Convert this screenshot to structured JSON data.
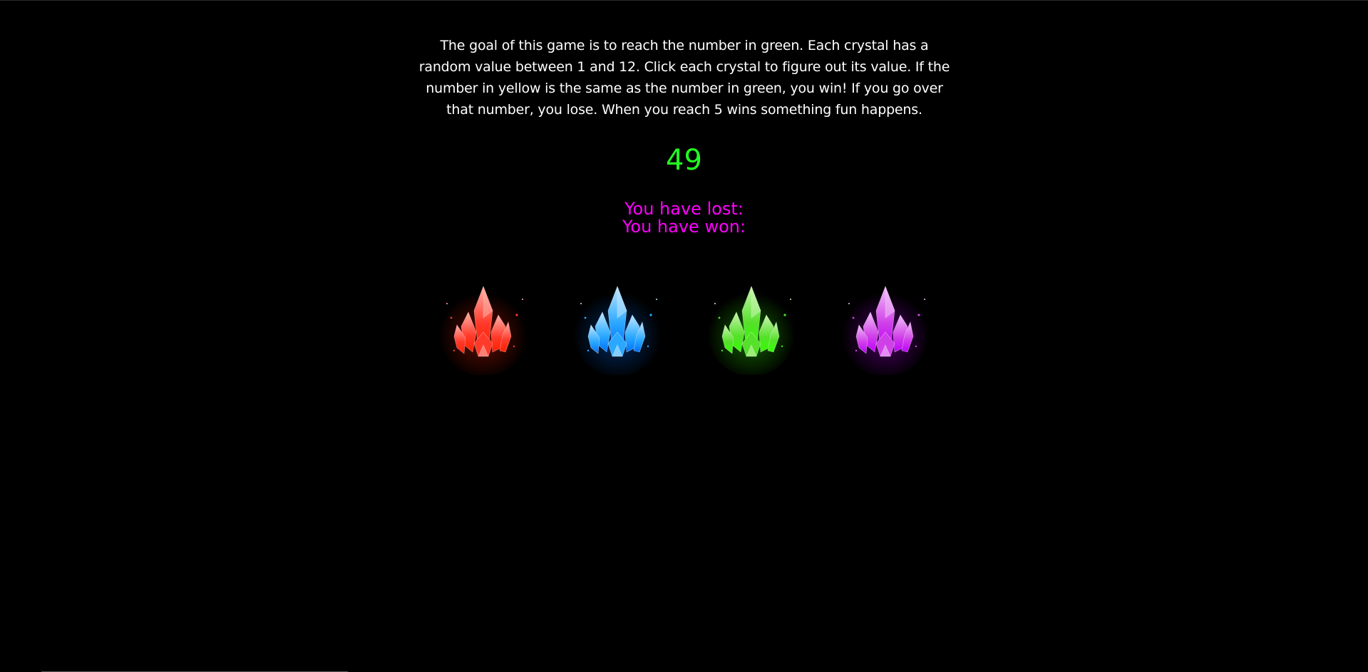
{
  "instructions": "The goal of this game is to reach the number in green. Each crystal has a random value between 1 and 12. Click each crystal to figure out its value. If the number in yellow is the same as the number in green, you win! If you go over that number, you lose. When you reach 5 wins something fun happens.",
  "target_number": "49",
  "score": {
    "lost_label": "You have lost:",
    "won_label": "You have won:"
  },
  "crystals": [
    {
      "name": "red",
      "color": "#ff3a2a",
      "glow": "#ff2000",
      "light": "#ffb0a8"
    },
    {
      "name": "blue",
      "color": "#2aa8ff",
      "glow": "#0070ff",
      "light": "#bfe6ff"
    },
    {
      "name": "green",
      "color": "#55e02a",
      "glow": "#30ff00",
      "light": "#c8f5b0"
    },
    {
      "name": "purple",
      "color": "#d040e8",
      "glow": "#c000ff",
      "light": "#f0c0f8"
    }
  ]
}
